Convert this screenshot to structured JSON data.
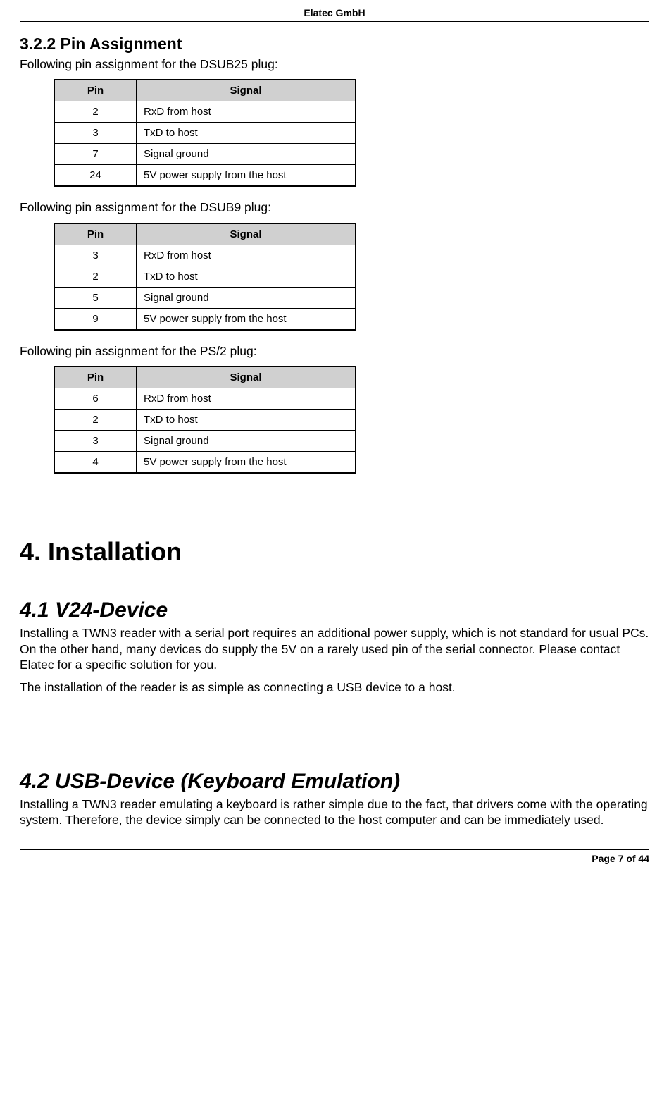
{
  "header": {
    "company": "Elatec GmbH"
  },
  "section_3_2_2": {
    "heading": "3.2.2  Pin Assignment",
    "intro1": "Following pin assignment for the DSUB25 plug:",
    "intro2": "Following pin assignment for the DSUB9 plug:",
    "intro3": "Following pin assignment for the PS/2 plug:",
    "col_pin": "Pin",
    "col_signal": "Signal",
    "table1": {
      "r0": {
        "pin": "2",
        "sig": "RxD from host"
      },
      "r1": {
        "pin": "3",
        "sig": "TxD to host"
      },
      "r2": {
        "pin": "7",
        "sig": "Signal ground"
      },
      "r3": {
        "pin": "24",
        "sig": "5V power supply from the host"
      }
    },
    "table2": {
      "r0": {
        "pin": "3",
        "sig": "RxD from host"
      },
      "r1": {
        "pin": "2",
        "sig": "TxD to host"
      },
      "r2": {
        "pin": "5",
        "sig": "Signal ground"
      },
      "r3": {
        "pin": "9",
        "sig": "5V power supply from the host"
      }
    },
    "table3": {
      "r0": {
        "pin": "6",
        "sig": "RxD from host"
      },
      "r1": {
        "pin": "2",
        "sig": "TxD to host"
      },
      "r2": {
        "pin": "3",
        "sig": "Signal ground"
      },
      "r3": {
        "pin": "4",
        "sig": "5V power supply from the host"
      }
    }
  },
  "chapter4": {
    "heading": "4. Installation",
    "sec41": {
      "heading": "4.1  V24-Device",
      "p1": "Installing a TWN3 reader with a serial port requires an additional power supply, which is not standard for usual PCs. On the other hand, many devices do supply the 5V on a rarely used pin of the serial connector. Please contact Elatec for a specific solution for you.",
      "p2": "The installation of the reader is as simple as connecting a USB device to a host."
    },
    "sec42": {
      "heading": "4.2  USB-Device (Keyboard Emulation)",
      "p1": "Installing a TWN3 reader emulating a keyboard is rather simple due to the fact, that drivers come with the operating system. Therefore, the device simply can be connected to the host computer and can be immediately used."
    }
  },
  "footer": {
    "page": "Page 7 of 44"
  }
}
